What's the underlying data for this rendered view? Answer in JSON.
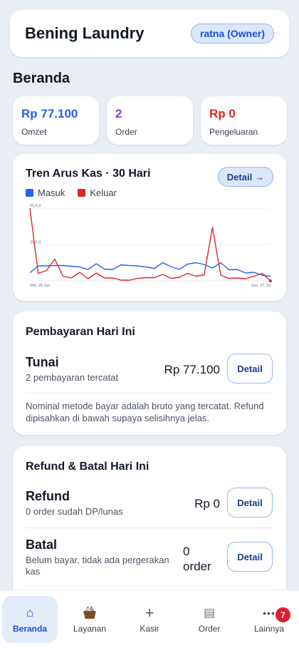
{
  "header": {
    "title": "Bening Laundry",
    "user": "ratna (Owner)"
  },
  "page_title": "Beranda",
  "stats": [
    {
      "value": "Rp 77.100",
      "label": "Omzet",
      "color": "#2563eb"
    },
    {
      "value": "2",
      "label": "Order",
      "color": "#7c3aed"
    },
    {
      "value": "Rp 0",
      "label": "Pengeluaran",
      "color": "#dc2626"
    }
  ],
  "chart_card": {
    "title": "Tren Arus Kas · 30 Hari",
    "detail_label": "Detail",
    "detail_arrow": "→"
  },
  "chart_data": {
    "type": "line",
    "y_tick_labels": [
      "20,4 jt",
      "10,2 jt"
    ],
    "x_tick_labels": [
      "Min, 28 Jun",
      "Sen, 27 Jul"
    ],
    "ylim": [
      0,
      20.4
    ],
    "y_unit": "jt",
    "legend_position": "top-left",
    "grid": true,
    "series": [
      {
        "name": "Masuk",
        "color": "#2563eb",
        "values": [
          2.3,
          4.2,
          4.2,
          4.3,
          4.3,
          4.1,
          3.9,
          3.2,
          4.8,
          3.3,
          3.2,
          4.5,
          4.3,
          4.2,
          3.9,
          3.5,
          5.1,
          4.0,
          3.2,
          4.7,
          5.1,
          4.6,
          3.6,
          5.1,
          3.1,
          3.2,
          2.2,
          2.4,
          1.6,
          1.3
        ]
      },
      {
        "name": "Keluar",
        "color": "#dc2626",
        "values": [
          20.4,
          2.1,
          2.9,
          6.1,
          1.3,
          0.8,
          2.4,
          0.6,
          2.2,
          0.8,
          0.8,
          0.2,
          0.2,
          0.7,
          0.9,
          0.9,
          1.8,
          0.7,
          1.0,
          2.1,
          1.3,
          1.7,
          15.0,
          1.6,
          0.7,
          0.8,
          0.6,
          1.3,
          2.1,
          0.0
        ]
      }
    ]
  },
  "payments": {
    "title": "Pembayaran Hari Ini",
    "method": "Tunai",
    "count_text": "2 pembayaran tercatat",
    "amount": "Rp 77.100",
    "detail_label": "Detail",
    "note": "Nominal metode bayar adalah bruto yang tercatat. Refund dipisahkan di bawah supaya selisihnya jelas."
  },
  "refunds": {
    "title": "Refund & Batal Hari Ini",
    "refund_title": "Refund",
    "refund_sub": "0 order sudah DP/lunas",
    "refund_amount": "Rp 0",
    "refund_detail": "Detail",
    "cancel_title": "Batal",
    "cancel_sub": "Belum bayar, tidak ada pergerakan kas",
    "cancel_amount": "0 order",
    "cancel_detail": "Detail"
  },
  "nav": [
    {
      "label": "Beranda",
      "icon": "home-icon",
      "glyph": "⌂"
    },
    {
      "label": "Layanan",
      "icon": "laundry-basket-icon",
      "glyph": "🧺"
    },
    {
      "label": "Kasir",
      "icon": "plus-icon",
      "glyph": "+"
    },
    {
      "label": "Order",
      "icon": "list-icon",
      "glyph": "▤"
    },
    {
      "label": "Lainnya",
      "icon": "more-icon",
      "glyph": "•••",
      "badge": "7"
    }
  ],
  "colors": {
    "accent": "#2563eb",
    "danger": "#dc2626",
    "purple": "#7c3aed",
    "background": "#e9eef5"
  }
}
